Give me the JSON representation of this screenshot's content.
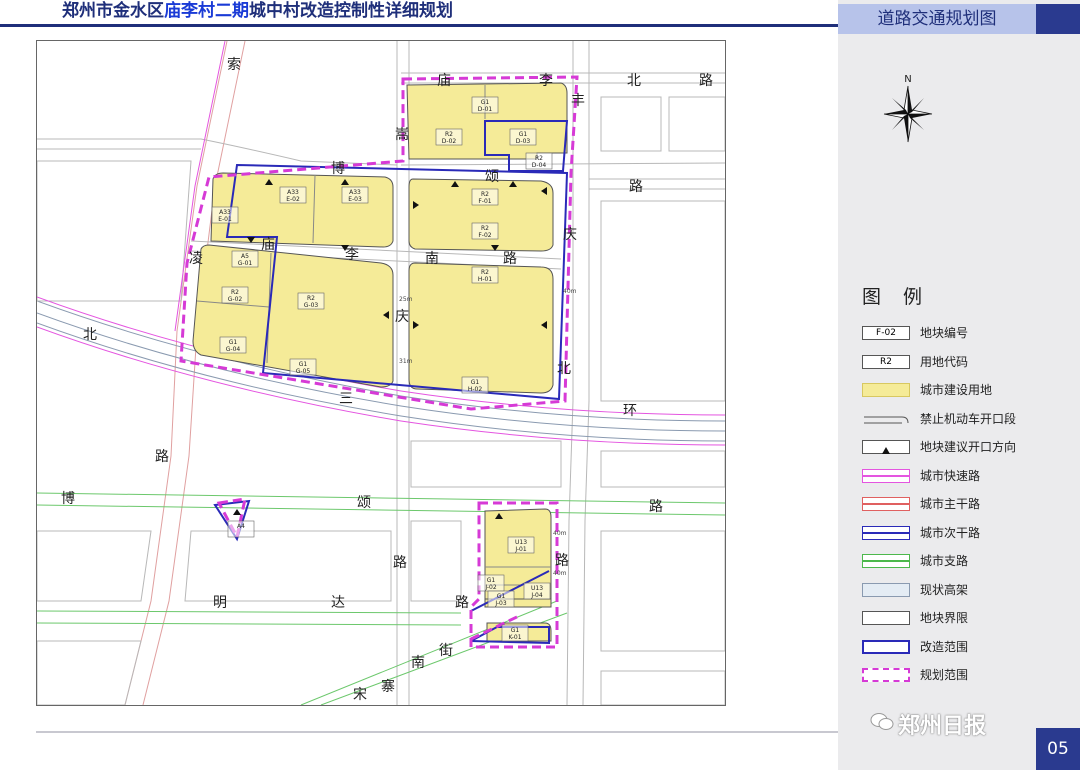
{
  "header": {
    "title_pre": "郑州市金水区",
    "title_hl": "庙李村二期",
    "title_post": "城中村改造控制性详细规划"
  },
  "sheet": {
    "tab_label": "道路交通规划图",
    "page_number": "05"
  },
  "compass": {
    "label": "N"
  },
  "watermark": {
    "text": "郑州日报",
    "icon": "wechat-icon"
  },
  "colors": {
    "land": "#f5eb98",
    "expressway": "#e455e0",
    "arterial": "#e06060",
    "secondary": "#2a2ab8",
    "branch": "#4cb84c",
    "plan_boundary": "#d63ad6",
    "navy": "#1f2f7a"
  },
  "legend": {
    "title": "图 例",
    "items": [
      {
        "label": "地块编号",
        "sample": "F-02"
      },
      {
        "label": "用地代码",
        "sample": "R2"
      },
      {
        "label": "城市建设用地"
      },
      {
        "label": "禁止机动车开口段"
      },
      {
        "label": "地块建议开口方向"
      },
      {
        "label": "城市快速路"
      },
      {
        "label": "城市主干路"
      },
      {
        "label": "城市次干路"
      },
      {
        "label": "城市支路"
      },
      {
        "label": "现状高架"
      },
      {
        "label": "地块界限"
      },
      {
        "label": "改造范围"
      },
      {
        "label": "规划范围"
      }
    ]
  },
  "roads": {
    "suo": "索",
    "miaoli_n": [
      "庙",
      "李"
    ],
    "feng": "丰",
    "bei": "北",
    "lu": "路",
    "fengqing_n": [
      "路"
    ],
    "xu": "嵩",
    "bosong_n": [
      "博",
      "颂"
    ],
    "ling": "凌",
    "miaoli_s": [
      "庙",
      "李",
      "南",
      "路"
    ],
    "qing": "庆",
    "qing2": "庆",
    "bei2": "北",
    "bei3": "北",
    "huan": "环",
    "san": "三",
    "lu2": "路",
    "bosong_s": [
      "博",
      "颂",
      "路"
    ],
    "lu3": "路",
    "lu4": "路",
    "mingda": [
      "明",
      "达",
      "路"
    ],
    "songzhai": [
      "宋",
      "寨",
      "南",
      "街"
    ]
  },
  "parcels": [
    {
      "id": "D-01",
      "code": "G1"
    },
    {
      "id": "D-02",
      "code": "R2"
    },
    {
      "id": "D-03",
      "code": "G1"
    },
    {
      "id": "D-04",
      "code": "R2"
    },
    {
      "id": "E-01",
      "code": "A33"
    },
    {
      "id": "E-02",
      "code": "A33"
    },
    {
      "id": "E-03",
      "code": "A33"
    },
    {
      "id": "F-01",
      "code": "R2"
    },
    {
      "id": "F-02",
      "code": "R2"
    },
    {
      "id": "G-01",
      "code": "A5"
    },
    {
      "id": "G-02",
      "code": "R2"
    },
    {
      "id": "G-03",
      "code": "R2"
    },
    {
      "id": "G-04",
      "code": "G1"
    },
    {
      "id": "G-05",
      "code": "G1"
    },
    {
      "id": "H-01",
      "code": "R2"
    },
    {
      "id": "H-02",
      "code": "G1"
    },
    {
      "id": "J-01",
      "code": "U13"
    },
    {
      "id": "J-02",
      "code": "G1"
    },
    {
      "id": "J-03",
      "code": "G1"
    },
    {
      "id": "J-04",
      "code": "U13"
    },
    {
      "id": "K-01",
      "code": "G1"
    },
    {
      "id": "",
      "code": "A4"
    }
  ],
  "dimensions": {
    "d1": "25m",
    "d2": "31m",
    "d3": "40m",
    "d4": "40m",
    "d5": "40m"
  }
}
